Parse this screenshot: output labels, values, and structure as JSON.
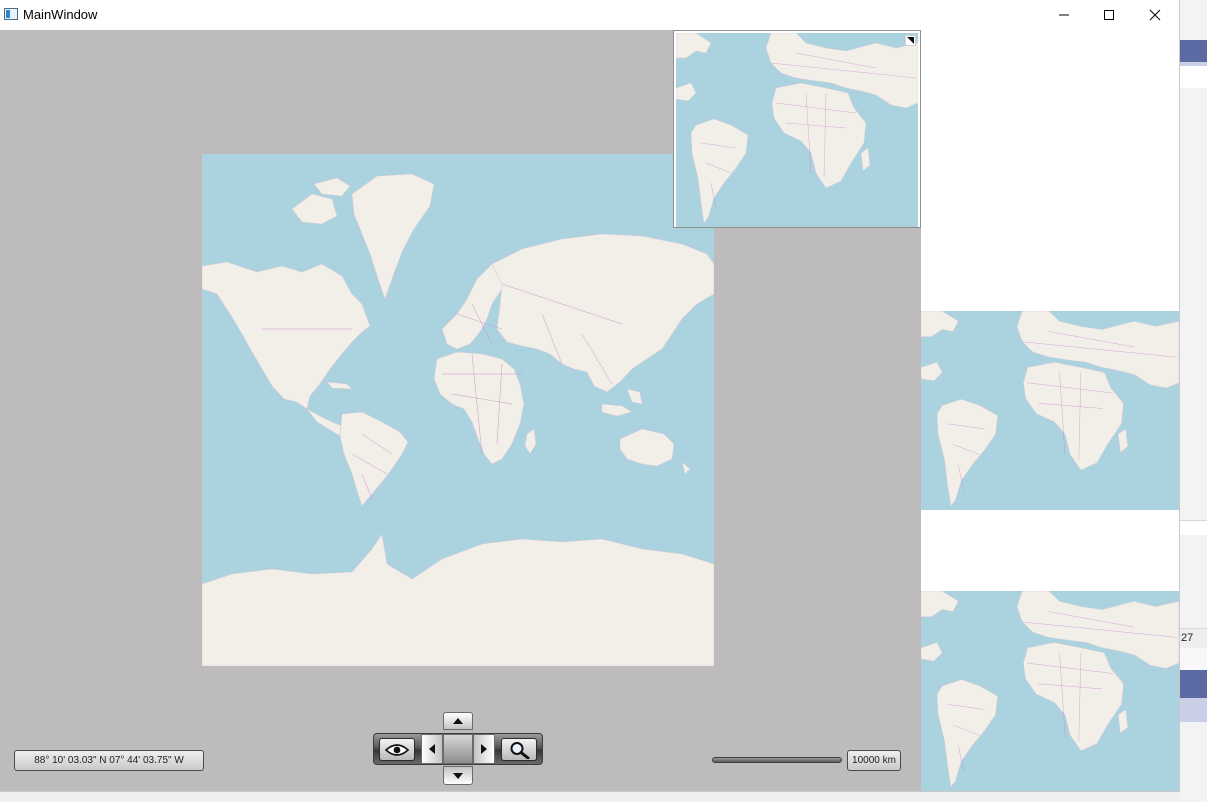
{
  "window": {
    "title": "MainWindow",
    "controls": [
      "minimize-icon",
      "maximize-icon",
      "close-icon"
    ]
  },
  "status": {
    "coordinates": "88° 10' 03.03\" N 07° 44' 03.75\" W",
    "scale_label": "10000 km"
  },
  "navigation": {
    "buttons": [
      "eye-icon",
      "pan-up-icon",
      "pan-left-icon",
      "pan-center",
      "pan-right-icon",
      "pan-down-icon",
      "magnifier-icon"
    ]
  },
  "background_app": {
    "visible_text": "27"
  },
  "colors": {
    "ocean": "#aad3df",
    "land": "#f2efe9",
    "borders": "#c77fc7",
    "map_background": "#bdbbbc"
  }
}
